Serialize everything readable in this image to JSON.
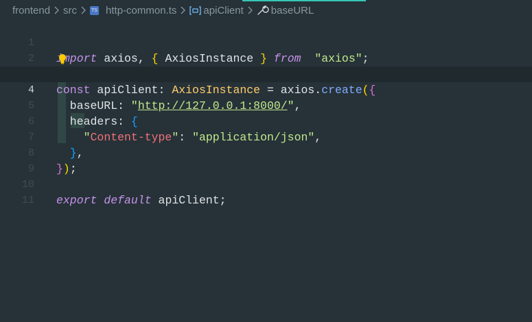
{
  "breadcrumb": {
    "items": [
      "frontend",
      "src",
      "http-common.ts",
      "apiClient",
      "baseURL"
    ],
    "ts_icon_text": "TS"
  },
  "editor": {
    "line_numbers": [
      "1",
      "2",
      "3",
      "4",
      "5",
      "6",
      "7",
      "8",
      "9",
      "10",
      "11"
    ],
    "current_line": "4",
    "code": {
      "l1": {
        "import": "import",
        "axios": " axios, ",
        "ob": "{",
        "inst": " AxiosInstance ",
        "cb": "}",
        "from": " from ",
        "str": "\"axios\"",
        "semi": ";"
      },
      "l3": {
        "const": "const",
        "name": " apiClient: ",
        "type": "AxiosInstance",
        "eq": " = axios.",
        "fn": "create",
        "paren": "(",
        "brace": "{"
      },
      "l4": {
        "key": "  baseURL: ",
        "q1": "\"",
        "url": "http://127.0.0.1:8000/",
        "q2": "\"",
        "comma": ","
      },
      "l5": {
        "key": "  headers: ",
        "brace": "{"
      },
      "l6": {
        "q1": "    \"",
        "key": "Content-type",
        "q2": "\"",
        "colon": ": ",
        "str": "\"application/json\"",
        "comma": ","
      },
      "l7": {
        "brace": "  }",
        "comma": ","
      },
      "l8": {
        "brace": "}",
        "paren": ")",
        "semi": ";"
      },
      "l10": {
        "export": "export",
        "default": " default",
        "rest": " apiClient;"
      }
    }
  },
  "colors": {
    "background": "#263238",
    "keyword": "#c792ea",
    "string": "#c3e88d",
    "property": "#f07178",
    "type": "#ffcb6b",
    "function": "#82aaff",
    "accent": "#35c7b5"
  },
  "icons": [
    "chevron-right-icon",
    "typescript-file-icon",
    "symbol-variable-icon",
    "wrench-icon",
    "lightbulb-icon"
  ]
}
